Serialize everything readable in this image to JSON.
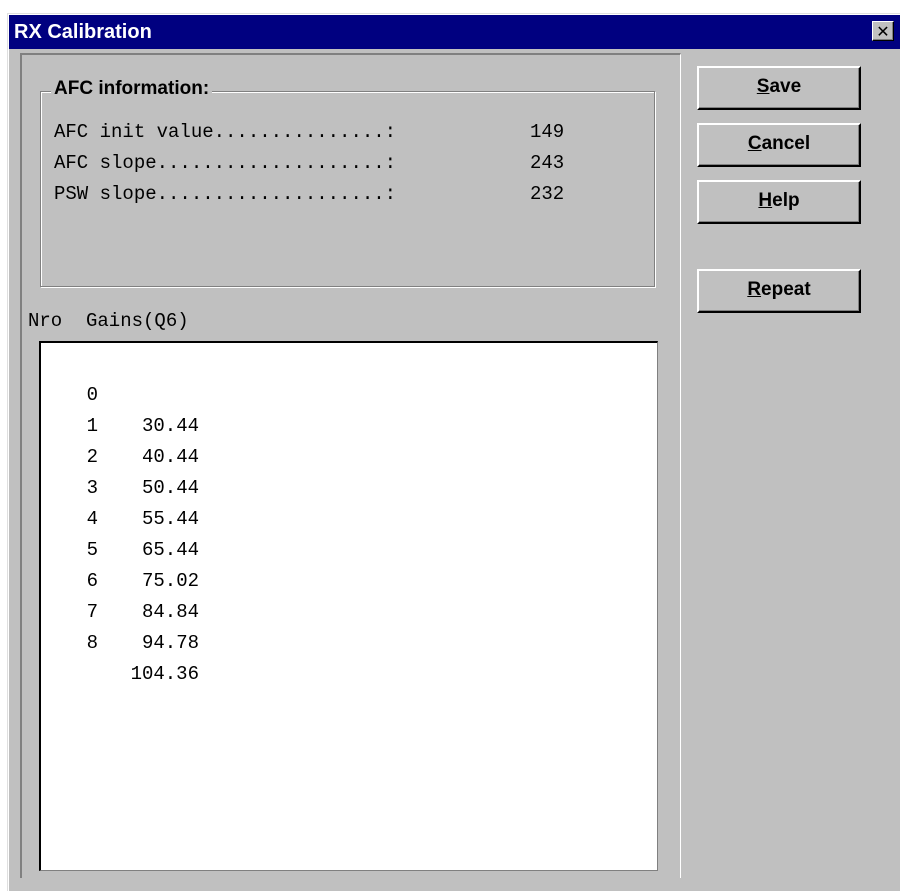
{
  "window": {
    "title": "RX Calibration",
    "close_glyph": "✕"
  },
  "afc": {
    "group_label": "AFC information:",
    "rows": [
      {
        "label": "AFC init value...............:",
        "value": "149"
      },
      {
        "label": "AFC slope....................:",
        "value": "243"
      },
      {
        "label": "PSW slope....................:",
        "value": "232"
      }
    ]
  },
  "gains": {
    "header_nro": "Nro",
    "header_gains": "Gains(Q6)",
    "rows": [
      {
        "nro": "0",
        "gain": "30.44"
      },
      {
        "nro": "1",
        "gain": "40.44"
      },
      {
        "nro": "2",
        "gain": "50.44"
      },
      {
        "nro": "3",
        "gain": "55.44"
      },
      {
        "nro": "4",
        "gain": "65.44"
      },
      {
        "nro": "5",
        "gain": "75.02"
      },
      {
        "nro": "6",
        "gain": "84.84"
      },
      {
        "nro": "7",
        "gain": "94.78"
      },
      {
        "nro": "8",
        "gain": "104.36"
      }
    ]
  },
  "buttons": {
    "save": {
      "mnemonic": "S",
      "rest": "ave"
    },
    "cancel": {
      "mnemonic": "C",
      "rest": "ancel"
    },
    "help": {
      "mnemonic": "H",
      "rest": "elp"
    },
    "repeat": {
      "mnemonic": "R",
      "rest": "epeat"
    }
  }
}
